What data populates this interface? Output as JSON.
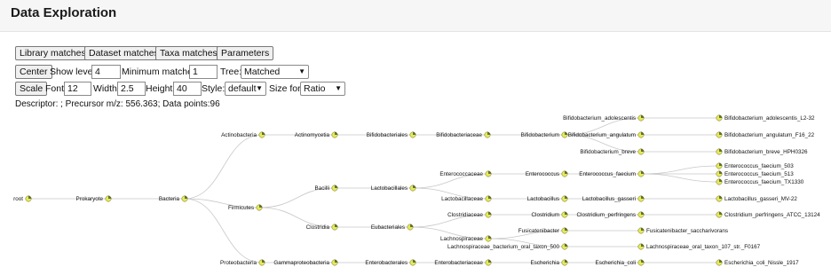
{
  "header": {
    "title": "Data Exploration"
  },
  "tabs": [
    {
      "label": "Library matches"
    },
    {
      "label": "Dataset matches"
    },
    {
      "label": "Taxa matches"
    },
    {
      "label": "Parameters"
    }
  ],
  "controls": {
    "center_label": "Center",
    "show_level_label": "Show level:",
    "show_level_value": "4",
    "min_matches_label": "Minimum matches:",
    "min_matches_value": "1",
    "tree_label": "Tree:",
    "tree_value": "Matched",
    "scale_label": "Scale",
    "font_label": "Font:",
    "font_value": "12",
    "width_label": "Width:",
    "width_value": "2.5",
    "height_label": "Height:",
    "height_value": "40",
    "style_label": "Style:",
    "style_value": "default",
    "size_for_label": "Size for:",
    "size_for_value": "Ratio"
  },
  "descriptor": "Descriptor: ; Precursor m/z: 556.363; Data points:96",
  "tree": {
    "nodes": [
      {
        "id": "root",
        "label": "root",
        "side": "left"
      },
      {
        "id": "prokaryote",
        "label": "Prokaryote",
        "side": "left"
      },
      {
        "id": "bacteria",
        "label": "Bacteria",
        "side": "left"
      },
      {
        "id": "actinobacteria",
        "label": "Actinobacteria",
        "side": "left"
      },
      {
        "id": "firmicutes",
        "label": "Firmicutes",
        "side": "left"
      },
      {
        "id": "proteobacteria",
        "label": "Proteobacteria",
        "side": "left"
      },
      {
        "id": "actinomycetia",
        "label": "Actinomycetia",
        "side": "left"
      },
      {
        "id": "bacilli",
        "label": "Bacilli",
        "side": "left"
      },
      {
        "id": "clostridia",
        "label": "Clostridia",
        "side": "left"
      },
      {
        "id": "gammaproteobacteria",
        "label": "Gammaproteobacteria",
        "side": "left"
      },
      {
        "id": "bifidobacteriales",
        "label": "Bifidobacteriales",
        "side": "left"
      },
      {
        "id": "lactobacillales",
        "label": "Lactobacillales",
        "side": "left"
      },
      {
        "id": "eubacteriales",
        "label": "Eubacteriales",
        "side": "left"
      },
      {
        "id": "enterobacterales",
        "label": "Enterobacterales",
        "side": "left"
      },
      {
        "id": "bifidobacteriaceae",
        "label": "Bifidobacteriaceae",
        "side": "left"
      },
      {
        "id": "enterococcaceae",
        "label": "Enterococcaceae",
        "side": "left"
      },
      {
        "id": "lactobacillaceae",
        "label": "Lactobacillaceae",
        "side": "left"
      },
      {
        "id": "clostridiaceae",
        "label": "Clostridiaceae",
        "side": "left"
      },
      {
        "id": "lachnospiraceae",
        "label": "Lachnospiraceae",
        "side": "left"
      },
      {
        "id": "enterobacteriaceae",
        "label": "Enterobacteriaceae",
        "side": "left"
      },
      {
        "id": "bifidobacterium",
        "label": "Bifidobacterium",
        "side": "left"
      },
      {
        "id": "enterococcus",
        "label": "Enterococcus",
        "side": "left"
      },
      {
        "id": "lactobacillus",
        "label": "Lactobacillus",
        "side": "left"
      },
      {
        "id": "clostridium",
        "label": "Clostridium",
        "side": "left"
      },
      {
        "id": "fusicatenibacter",
        "label": "Fusicatenibacter",
        "side": "left"
      },
      {
        "id": "lachno_500",
        "label": "Lachnospiraceae_bacterium_oral_taxon_500",
        "side": "left"
      },
      {
        "id": "escherichia",
        "label": "Escherichia",
        "side": "left"
      },
      {
        "id": "bif_adolescentis",
        "label": "Bifidobacterium_adolescentis",
        "side": "left"
      },
      {
        "id": "bif_angulatum",
        "label": "Bifidobacterium_angulatum",
        "side": "left"
      },
      {
        "id": "bif_breve",
        "label": "Bifidobacterium_breve",
        "side": "left"
      },
      {
        "id": "ent_faecium",
        "label": "Enterococcus_faecium",
        "side": "left"
      },
      {
        "id": "lac_gasseri",
        "label": "Lactobacillus_gasseri",
        "side": "left"
      },
      {
        "id": "clo_perfringens",
        "label": "Clostridium_perfringens",
        "side": "left"
      },
      {
        "id": "fus_saccharivorans",
        "label": "Fusicatenibacter_saccharivorans",
        "side": "right"
      },
      {
        "id": "lachno_107",
        "label": "Lachnospiraceae_oral_taxon_107_str._F0167",
        "side": "right"
      },
      {
        "id": "esc_coli",
        "label": "Escherichia_coli",
        "side": "left"
      },
      {
        "id": "s_adol_l2",
        "label": "Bifidobacterium_adolescentis_L2-32",
        "side": "right"
      },
      {
        "id": "s_angul_f16",
        "label": "Bifidobacterium_angulatum_F16_22",
        "side": "right"
      },
      {
        "id": "s_breve_hph",
        "label": "Bifidobacterium_breve_HPH0326",
        "side": "right"
      },
      {
        "id": "s_fae_503",
        "label": "Enterococcus_faecium_503",
        "side": "right"
      },
      {
        "id": "s_fae_513",
        "label": "Enterococcus_faecium_513",
        "side": "right"
      },
      {
        "id": "s_fae_tx",
        "label": "Enterococcus_faecium_TX1330",
        "side": "right"
      },
      {
        "id": "s_gass_mv",
        "label": "Lactobacillus_gasseri_MV-22",
        "side": "right"
      },
      {
        "id": "s_perf_atcc",
        "label": "Clostridium_perfringens_ATCC_13124",
        "side": "right"
      },
      {
        "id": "s_coli_nissle",
        "label": "Escherichia_coli_Nissle_1917",
        "side": "right"
      }
    ],
    "edges": [
      [
        "root",
        "prokaryote"
      ],
      [
        "prokaryote",
        "bacteria"
      ],
      [
        "bacteria",
        "actinobacteria"
      ],
      [
        "bacteria",
        "firmicutes"
      ],
      [
        "bacteria",
        "proteobacteria"
      ],
      [
        "actinobacteria",
        "actinomycetia"
      ],
      [
        "actinomycetia",
        "bifidobacteriales"
      ],
      [
        "bifidobacteriales",
        "bifidobacteriaceae"
      ],
      [
        "bifidobacteriaceae",
        "bifidobacterium"
      ],
      [
        "bifidobacterium",
        "bif_adolescentis"
      ],
      [
        "bifidobacterium",
        "bif_angulatum"
      ],
      [
        "bifidobacterium",
        "bif_breve"
      ],
      [
        "bif_adolescentis",
        "s_adol_l2"
      ],
      [
        "bif_angulatum",
        "s_angul_f16"
      ],
      [
        "bif_breve",
        "s_breve_hph"
      ],
      [
        "firmicutes",
        "bacilli"
      ],
      [
        "firmicutes",
        "clostridia"
      ],
      [
        "bacilli",
        "lactobacillales"
      ],
      [
        "lactobacillales",
        "enterococcaceae"
      ],
      [
        "lactobacillales",
        "lactobacillaceae"
      ],
      [
        "enterococcaceae",
        "enterococcus"
      ],
      [
        "enterococcus",
        "ent_faecium"
      ],
      [
        "ent_faecium",
        "s_fae_503"
      ],
      [
        "ent_faecium",
        "s_fae_513"
      ],
      [
        "ent_faecium",
        "s_fae_tx"
      ],
      [
        "lactobacillaceae",
        "lactobacillus"
      ],
      [
        "lactobacillus",
        "lac_gasseri"
      ],
      [
        "lac_gasseri",
        "s_gass_mv"
      ],
      [
        "clostridia",
        "eubacteriales"
      ],
      [
        "eubacteriales",
        "clostridiaceae"
      ],
      [
        "eubacteriales",
        "lachnospiraceae"
      ],
      [
        "clostridiaceae",
        "clostridium"
      ],
      [
        "clostridium",
        "clo_perfringens"
      ],
      [
        "clo_perfringens",
        "s_perf_atcc"
      ],
      [
        "lachnospiraceae",
        "fusicatenibacter"
      ],
      [
        "lachnospiraceae",
        "lachno_500"
      ],
      [
        "fusicatenibacter",
        "fus_saccharivorans"
      ],
      [
        "lachno_500",
        "lachno_107"
      ],
      [
        "proteobacteria",
        "gammaproteobacteria"
      ],
      [
        "gammaproteobacteria",
        "enterobacterales"
      ],
      [
        "enterobacterales",
        "enterobacteriaceae"
      ],
      [
        "enterobacteriaceae",
        "escherichia"
      ],
      [
        "escherichia",
        "esc_coli"
      ],
      [
        "esc_coli",
        "s_coli_nissle"
      ]
    ],
    "colors": {
      "node_fill": "#e8e85a",
      "node_stroke": "#6b6b2a",
      "pie_fill": "#2f4f1f",
      "edge": "#c8c8c8"
    }
  }
}
